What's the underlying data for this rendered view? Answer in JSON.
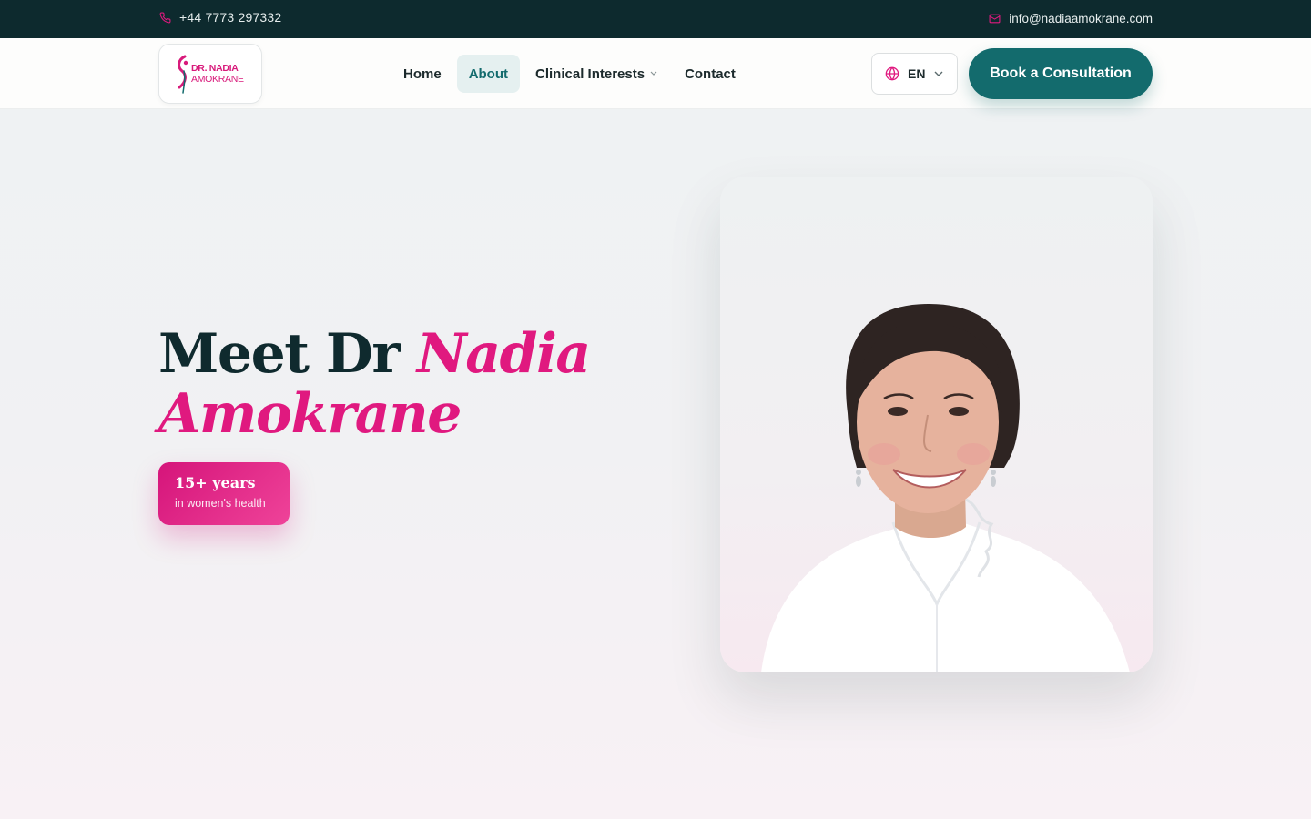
{
  "topbar": {
    "phone": "+44 7773 297332",
    "email": "info@nadiaamokrane.com",
    "phone_icon": "phone-icon",
    "email_icon": "mail-icon"
  },
  "logo": {
    "line1": "DR. NADIA",
    "line2": "AMOKRANE"
  },
  "nav": {
    "items": [
      {
        "label": "Home"
      },
      {
        "label": "About"
      },
      {
        "label": "Clinical Interests"
      },
      {
        "label": "Contact"
      }
    ],
    "active": "About"
  },
  "language": {
    "value": "EN",
    "icon": "globe-icon"
  },
  "cta": {
    "label": "Book a Consultation"
  },
  "hero": {
    "title_plain": "Meet Dr",
    "title_accent_1": "Nadia",
    "title_accent_2": "Amokrane"
  },
  "badge": {
    "value": "15+ years",
    "caption": "in women's health"
  },
  "colors": {
    "brand_teal": "#136b6d",
    "brand_pink": "#e0197f",
    "topbar_bg": "#0d2a2e"
  }
}
